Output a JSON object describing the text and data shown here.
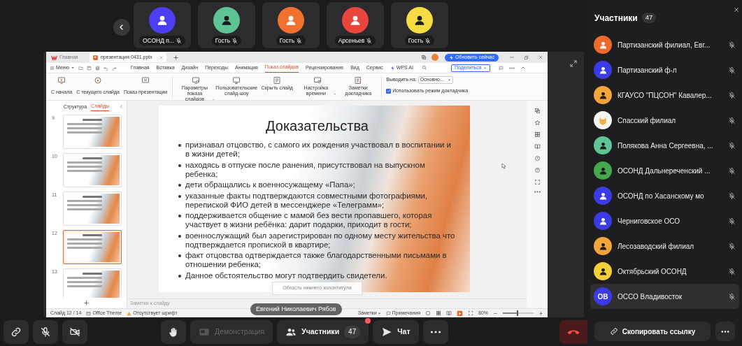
{
  "video_tiles": [
    {
      "name": "ОСОНД п...",
      "color": "#4b3ff0",
      "dark_icon": false,
      "muted": true
    },
    {
      "name": "Гость",
      "color": "#5ec495",
      "dark_icon": true,
      "muted": true
    },
    {
      "name": "Гость",
      "color": "#f0702e",
      "dark_icon": false,
      "muted": true
    },
    {
      "name": "Арсеньев",
      "color": "#e8453c",
      "dark_icon": false,
      "muted": true
    },
    {
      "name": "Гость",
      "color": "#f5dc45",
      "dark_icon": true,
      "muted": true
    }
  ],
  "shared_screen": {
    "speaker": "Евгений Николаевич Рябов",
    "app_tabs": [
      {
        "label": "Главная",
        "kind": "home",
        "selected": false
      },
      {
        "label": "презентация 0431.pptx",
        "kind": "document",
        "selected": true
      }
    ],
    "update_button": "Обновить сейчас",
    "menu_label": "Меню",
    "ribbon_tabs": [
      {
        "label": "Главная",
        "selected": false
      },
      {
        "label": "Вставка",
        "selected": false
      },
      {
        "label": "Дизайн",
        "selected": false
      },
      {
        "label": "Переходы",
        "selected": false
      },
      {
        "label": "Анимация",
        "selected": false
      },
      {
        "label": "Показ слайдов",
        "selected": true
      },
      {
        "label": "Рецензирование",
        "selected": false
      },
      {
        "label": "Вид",
        "selected": false
      },
      {
        "label": "Сервис",
        "selected": false
      },
      {
        "label": "WPS AI",
        "selected": false,
        "kind": "ai"
      }
    ],
    "share_button": "Поделиться",
    "ribbon_groups": [
      [
        {
          "label": "С начала",
          "kind": "start"
        },
        {
          "label": "С текущего слайда",
          "kind": "current"
        },
        {
          "label": "Показ презентации",
          "kind": "show"
        }
      ],
      [
        {
          "label": "Параметры показа слайдов",
          "kind": "settings",
          "dropdown": true
        },
        {
          "label": "Пользовательские слайд-шоу",
          "kind": "custom",
          "dropdown": false
        },
        {
          "label": "Скрыть слайд",
          "kind": "hide",
          "dropdown": false
        },
        {
          "label": "Настройка времени",
          "kind": "timer",
          "dropdown": true
        },
        {
          "label": "Заметки докладчика",
          "kind": "notes",
          "dropdown": false
        }
      ]
    ],
    "output": {
      "label": "Выводить на:",
      "value": "Основно..."
    },
    "presenter_mode": {
      "label": "Использовать режим докладчика",
      "checked": true
    },
    "panel_tabs": [
      {
        "label": "Структура",
        "selected": false
      },
      {
        "label": "Слайды",
        "selected": true
      }
    ],
    "thumbnails": [
      {
        "number": "9",
        "selected": false
      },
      {
        "number": "10",
        "selected": false
      },
      {
        "number": "11",
        "selected": false
      },
      {
        "number": "12",
        "selected": true
      },
      {
        "number": "13",
        "selected": false
      }
    ],
    "slide": {
      "title": "Доказательства",
      "bullets": [
        "признавал отцовство, с самого их рождения участвовал в воспитании и в жизни  детей;",
        "находясь в отпуске после ранения, присутствовал на выпускном ребенка;",
        "дети обращались к военносужащему «Папа»;",
        "указанные факты подтверждаются совместными фотографиями, перепиской ФИО детей в мессенджере «Телеграмм»;",
        "поддерживается общение с мамой без вести пропавшего, которая участвует в жизни ребёнка: дарит подарки, приходит в гости;",
        "военнослужащий был зарегистрирован по одному месту жительства что подтверждается пропиской  в квартире;",
        "факт отцовства одтверждается также благодарственными письмами в отношении ребенка;",
        "Данное обстоятельство могут подтвердить свидетели."
      ],
      "footer": "Область нижнего колонтитула"
    },
    "notes_placeholder": "Заметки к слайду",
    "status": {
      "slide": "Слайд 12 / 14",
      "theme": "Office Theme",
      "font_warning": "Отсутствует шрифт",
      "notes": "Заметки",
      "comments": "Примечания",
      "zoom": "80%",
      "level": 0.45
    }
  },
  "controls": [
    {
      "kind": "link"
    },
    {
      "kind": "mic",
      "muted": true
    },
    {
      "kind": "camera",
      "on": false
    },
    {
      "kind": "hand"
    },
    {
      "kind": "screen",
      "label": "Демонстрация",
      "disabled": true
    },
    {
      "kind": "participants",
      "label": "Участники",
      "count": "47",
      "notification": true
    },
    {
      "kind": "chat",
      "label": "Чат"
    },
    {
      "kind": "more"
    },
    {
      "kind": "hangup"
    }
  ],
  "participants_panel": {
    "title": "Участники",
    "count": "47",
    "participants": [
      {
        "name": "Партизанский филиал, Евг...",
        "kind": "avatar",
        "color": "#ec6a2c",
        "dark_icon": false,
        "muted": true,
        "selected": false
      },
      {
        "name": "Партизанский ф-л",
        "kind": "avatar",
        "color": "#3b3be6",
        "dark_icon": false,
        "muted": true,
        "selected": false
      },
      {
        "name": "КГАУСО \"ПЦСОН\" Кавалер...",
        "kind": "avatar",
        "color": "#f0a43a",
        "dark_icon": true,
        "muted": true,
        "selected": false
      },
      {
        "name": "Спасский филиал",
        "kind": "image",
        "color": "#f4f4ee",
        "muted": true,
        "selected": false
      },
      {
        "name": "Полякова Анна Сергеевна, ...",
        "kind": "avatar",
        "color": "#5ec495",
        "dark_icon": true,
        "muted": true,
        "selected": false
      },
      {
        "name": "ОСОНД Дальнереченский ...",
        "kind": "avatar",
        "color": "#44a84c",
        "dark_icon": true,
        "muted": true,
        "selected": false
      },
      {
        "name": "ОСОНД по Хасанскому мо",
        "kind": "avatar",
        "color": "#3b3be6",
        "dark_icon": false,
        "muted": true,
        "selected": false
      },
      {
        "name": "Черниговское ОСО",
        "kind": "avatar",
        "color": "#3b3be6",
        "dark_icon": false,
        "muted": true,
        "selected": false
      },
      {
        "name": "Лесозаводский филиал",
        "kind": "avatar",
        "color": "#f0a43a",
        "dark_icon": true,
        "muted": true,
        "selected": false
      },
      {
        "name": "Октябрьский ОСОНД",
        "kind": "avatar",
        "color": "#f5cf3a",
        "dark_icon": true,
        "muted": true,
        "selected": false
      },
      {
        "name": "ОССО Владивосток",
        "kind": "initials",
        "initials": "ОВ",
        "color": "#3b3be6",
        "muted": true,
        "selected": true
      }
    ],
    "copy_link": "Скопировать ссылку"
  }
}
